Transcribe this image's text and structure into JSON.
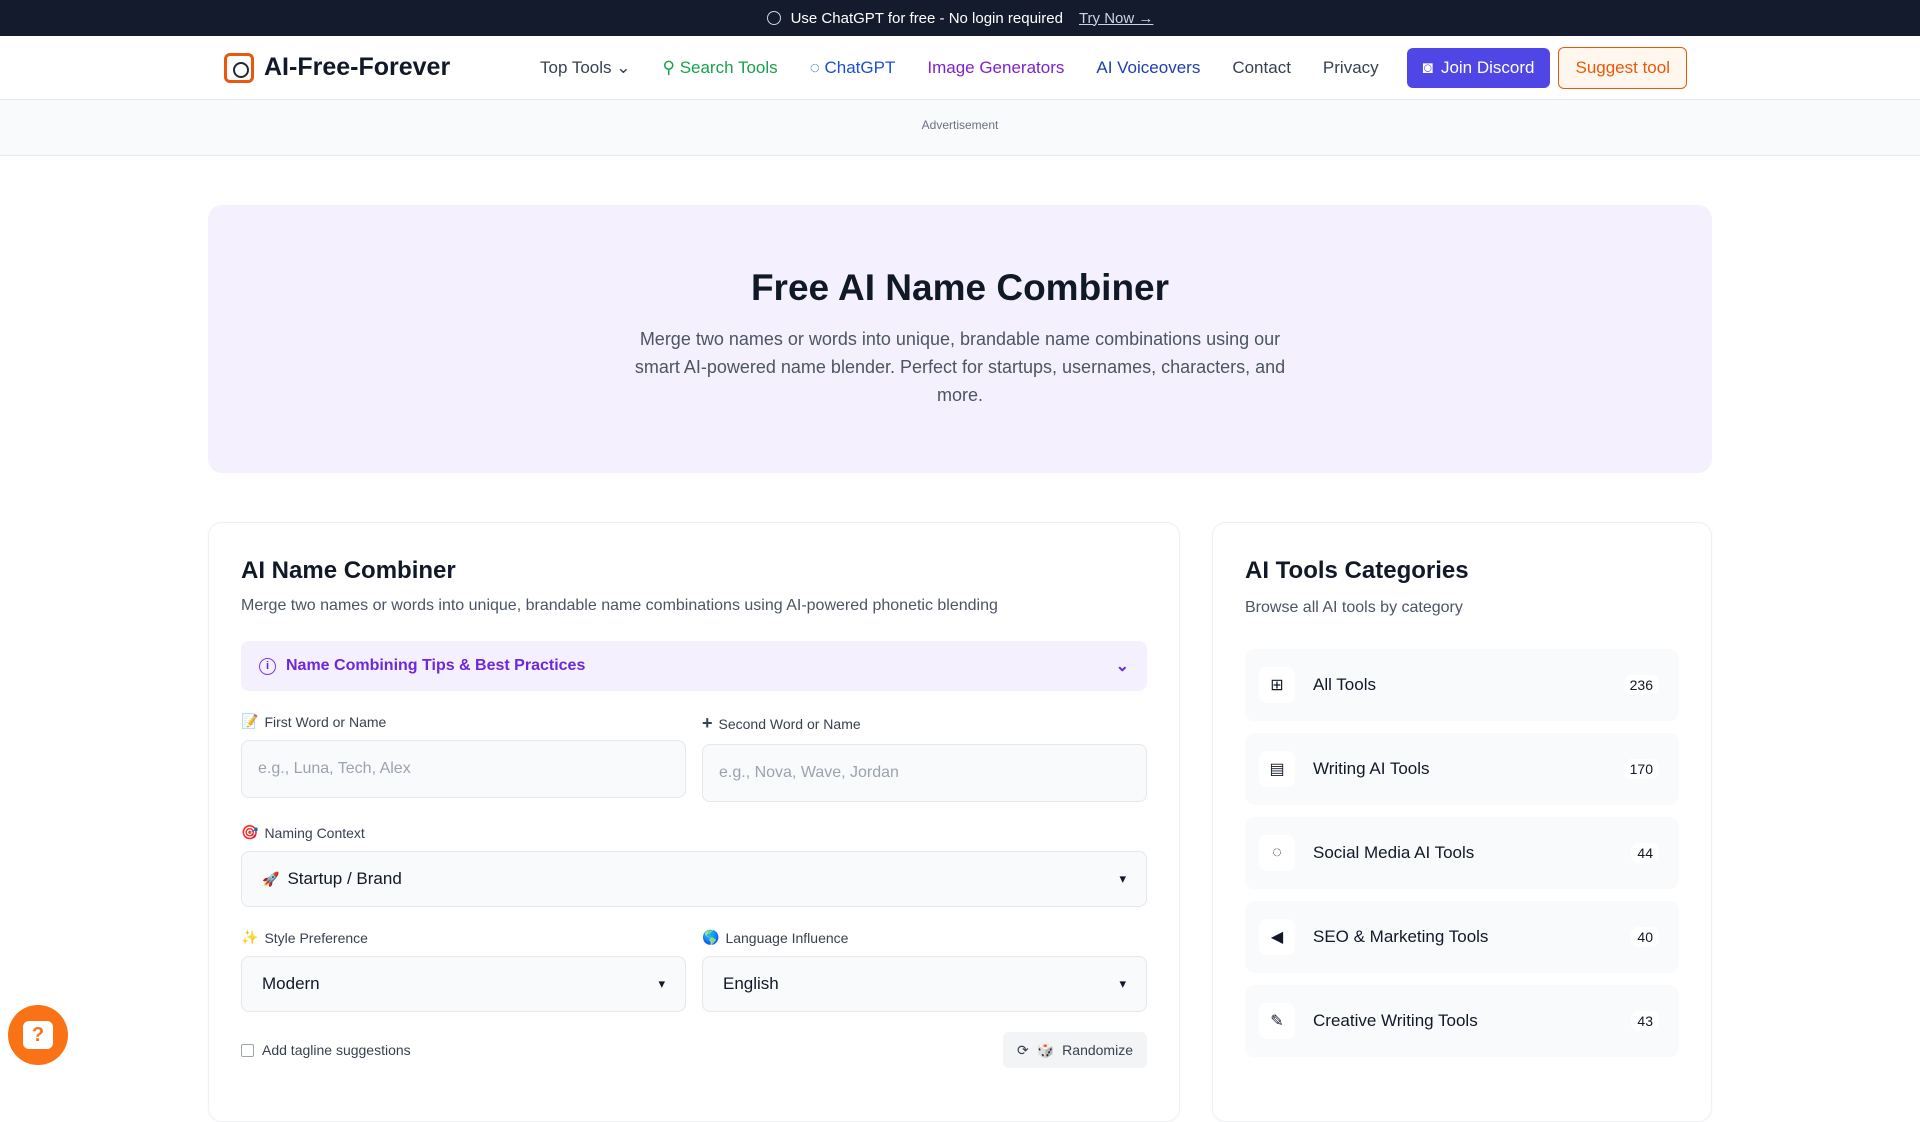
{
  "topbar": {
    "text": "Use ChatGPT for free - No login required",
    "link": "Try Now →"
  },
  "nav": {
    "logo": "AI-Free-Forever",
    "links": {
      "top_tools": "Top Tools",
      "search_tools": "Search Tools",
      "chatgpt": "ChatGPT",
      "image_generators": "Image Generators",
      "ai_voiceovers": "AI Voiceovers",
      "contact": "Contact",
      "privacy": "Privacy"
    },
    "discord": "Join Discord",
    "suggest": "Suggest tool"
  },
  "ad": {
    "label": "Advertisement"
  },
  "hero": {
    "title": "Free AI Name Combiner",
    "subtitle": "Merge two names or words into unique, brandable name combinations using our smart AI-powered name blender. Perfect for startups, usernames, characters, and more."
  },
  "tool": {
    "title": "AI Name Combiner",
    "subtitle": "Merge two names or words into unique, brandable name combinations using AI-powered phonetic blending",
    "tips": "Name Combining Tips & Best Practices",
    "first_label": "First Word or Name",
    "first_placeholder": "e.g., Luna, Tech, Alex",
    "second_label": "Second Word or Name",
    "second_placeholder": "e.g., Nova, Wave, Jordan",
    "context_label": "Naming Context",
    "context_value": "Startup / Brand",
    "style_label": "Style Preference",
    "style_value": "Modern",
    "language_label": "Language Influence",
    "language_value": "English",
    "tagline_label": "Add tagline suggestions",
    "randomize": "Randomize"
  },
  "categories": {
    "title": "AI Tools Categories",
    "subtitle": "Browse all AI tools by category",
    "items": [
      {
        "label": "All Tools",
        "count": "236",
        "icon": "grid-icon"
      },
      {
        "label": "Writing AI Tools",
        "count": "170",
        "icon": "document-icon"
      },
      {
        "label": "Social Media AI Tools",
        "count": "44",
        "icon": "chat-icon"
      },
      {
        "label": "SEO & Marketing Tools",
        "count": "40",
        "icon": "megaphone-icon"
      },
      {
        "label": "Creative Writing Tools",
        "count": "43",
        "icon": "pencil-icon"
      }
    ]
  }
}
